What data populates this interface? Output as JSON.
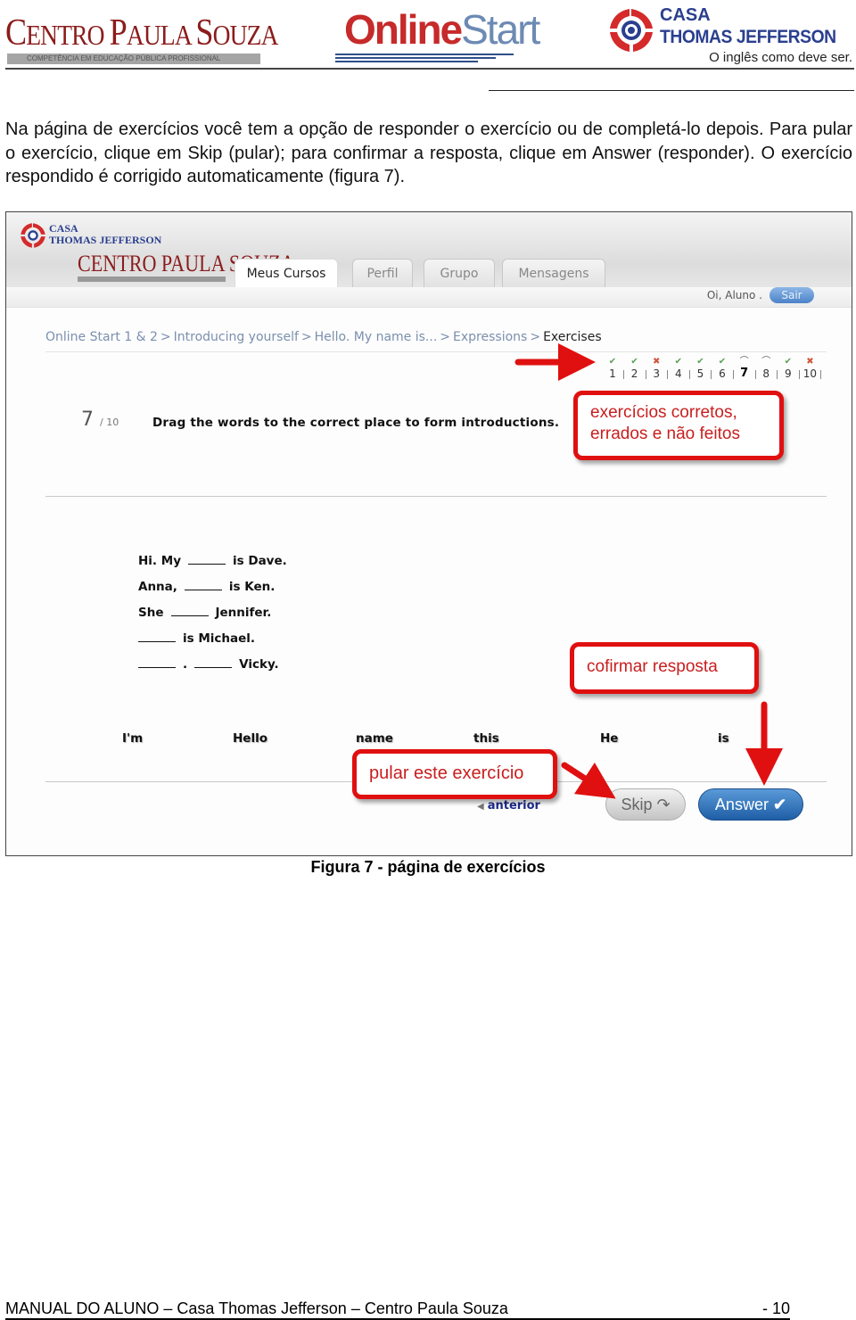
{
  "header": {
    "left_logo": {
      "title_parts": [
        "C",
        "ENTRO ",
        "P",
        "AULA ",
        "S",
        "OUZA"
      ],
      "tagline": "COMPETÊNCIA EM EDUCAÇÃO PÚBLICA PROFISSIONAL"
    },
    "center_logo": {
      "part1": "Online",
      "part2": "Start"
    },
    "right_logo": {
      "line1": "CASA",
      "line2": "THOMAS JEFFERSON",
      "slogan": "O inglês como deve ser."
    }
  },
  "paragraph": "Na página de exercícios você tem a opção de responder o exercício ou de completá-lo depois. Para pular o exercício, clique em Skip (pular); para confirmar a resposta, clique em Answer (responder). O exercício respondido é corrigido automaticamente (figura 7).",
  "figure": {
    "app": {
      "logo_ctj": {
        "line1": "CASA",
        "line2": "THOMAS JEFFERSON"
      },
      "logo_cps": "CENTRO PAULA SOUZA",
      "tabs": [
        {
          "label": "Meus Cursos",
          "active": true
        },
        {
          "label": "Perfil",
          "active": false
        },
        {
          "label": "Grupo",
          "active": false
        },
        {
          "label": "Mensagens",
          "active": false
        }
      ],
      "greeting": "Oi, Aluno .",
      "logout_label": "Sair",
      "breadcrumb": [
        "Online Start 1 & 2",
        "Introducing yourself",
        "Hello. My name is...",
        "Expressions",
        "Exercises"
      ],
      "breadcrumb_separator": ">",
      "progress": [
        {
          "num": "1",
          "status": "correct"
        },
        {
          "num": "2",
          "status": "correct"
        },
        {
          "num": "3",
          "status": "wrong"
        },
        {
          "num": "4",
          "status": "correct"
        },
        {
          "num": "5",
          "status": "correct"
        },
        {
          "num": "6",
          "status": "correct"
        },
        {
          "num": "7",
          "status": "current"
        },
        {
          "num": "8",
          "status": "pending"
        },
        {
          "num": "9",
          "status": "correct"
        },
        {
          "num": "10",
          "status": "wrong"
        }
      ],
      "question_number": "7",
      "question_total": "/ 10",
      "instruction": "Drag the words to the correct place to form introductions.",
      "sentences": [
        {
          "before": "Hi. My",
          "mid": "",
          "after": "is Dave."
        },
        {
          "before": "Anna,",
          "mid": "",
          "after": "is Ken."
        },
        {
          "before": "She",
          "mid": "",
          "after": "Jennifer."
        },
        {
          "before": "",
          "mid": "",
          "after": "is Michael."
        },
        {
          "before": "",
          "mid": ".",
          "after": "Vicky."
        }
      ],
      "word_bank": [
        "I'm",
        "Hello",
        "name",
        "this",
        "He",
        "is"
      ],
      "previous_label": "anterior",
      "skip_label": "Skip",
      "answer_label": "Answer"
    },
    "annotations": {
      "progress_note": "exercícios corretos, errados e não feitos",
      "confirm_note": "cofirmar resposta",
      "skip_note": "pular este exercício"
    },
    "colors": {
      "annotation_red": "#e01010",
      "answer_blue": "#1f5ea6",
      "correct_green": "#5aa05a",
      "wrong_red": "#d2553a"
    },
    "caption": "Figura 7 - página de exercícios"
  },
  "footer": {
    "text": "MANUAL DO ALUNO – Casa Thomas Jefferson – Centro Paula Souza",
    "page": "- 10"
  }
}
